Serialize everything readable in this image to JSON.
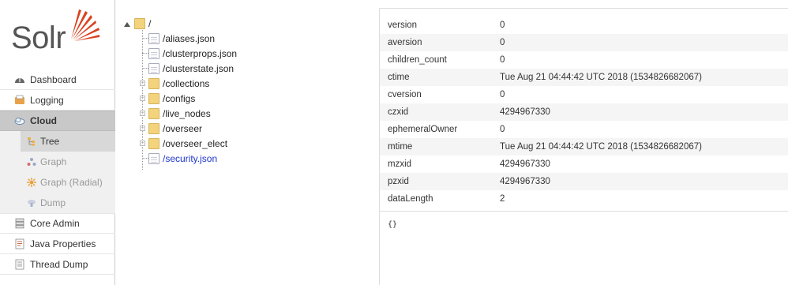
{
  "logo": {
    "text": "Solr",
    "accent": "#d9411e"
  },
  "nav": {
    "dashboard": "Dashboard",
    "logging": "Logging",
    "cloud": "Cloud",
    "cloud_sub": {
      "tree": "Tree",
      "graph": "Graph",
      "graph_radial": "Graph (Radial)",
      "dump": "Dump"
    },
    "core_admin": "Core Admin",
    "java_properties": "Java Properties",
    "thread_dump": "Thread Dump"
  },
  "tree": {
    "root": "/",
    "items": [
      {
        "label": "/aliases.json",
        "type": "file"
      },
      {
        "label": "/clusterprops.json",
        "type": "file"
      },
      {
        "label": "/clusterstate.json",
        "type": "file"
      },
      {
        "label": "/collections",
        "type": "folder"
      },
      {
        "label": "/configs",
        "type": "folder"
      },
      {
        "label": "/live_nodes",
        "type": "folder"
      },
      {
        "label": "/overseer",
        "type": "folder"
      },
      {
        "label": "/overseer_elect",
        "type": "folder"
      },
      {
        "label": "/security.json",
        "type": "file",
        "selected": true
      }
    ]
  },
  "properties": [
    {
      "key": "version",
      "value": "0"
    },
    {
      "key": "aversion",
      "value": "0"
    },
    {
      "key": "children_count",
      "value": "0"
    },
    {
      "key": "ctime",
      "value": "Tue Aug 21 04:44:42 UTC 2018 (1534826682067)"
    },
    {
      "key": "cversion",
      "value": "0"
    },
    {
      "key": "czxid",
      "value": "4294967330"
    },
    {
      "key": "ephemeralOwner",
      "value": "0"
    },
    {
      "key": "mtime",
      "value": "Tue Aug 21 04:44:42 UTC 2018 (1534826682067)"
    },
    {
      "key": "mzxid",
      "value": "4294967330"
    },
    {
      "key": "pzxid",
      "value": "4294967330"
    },
    {
      "key": "dataLength",
      "value": "2"
    }
  ],
  "file_content": "{}"
}
